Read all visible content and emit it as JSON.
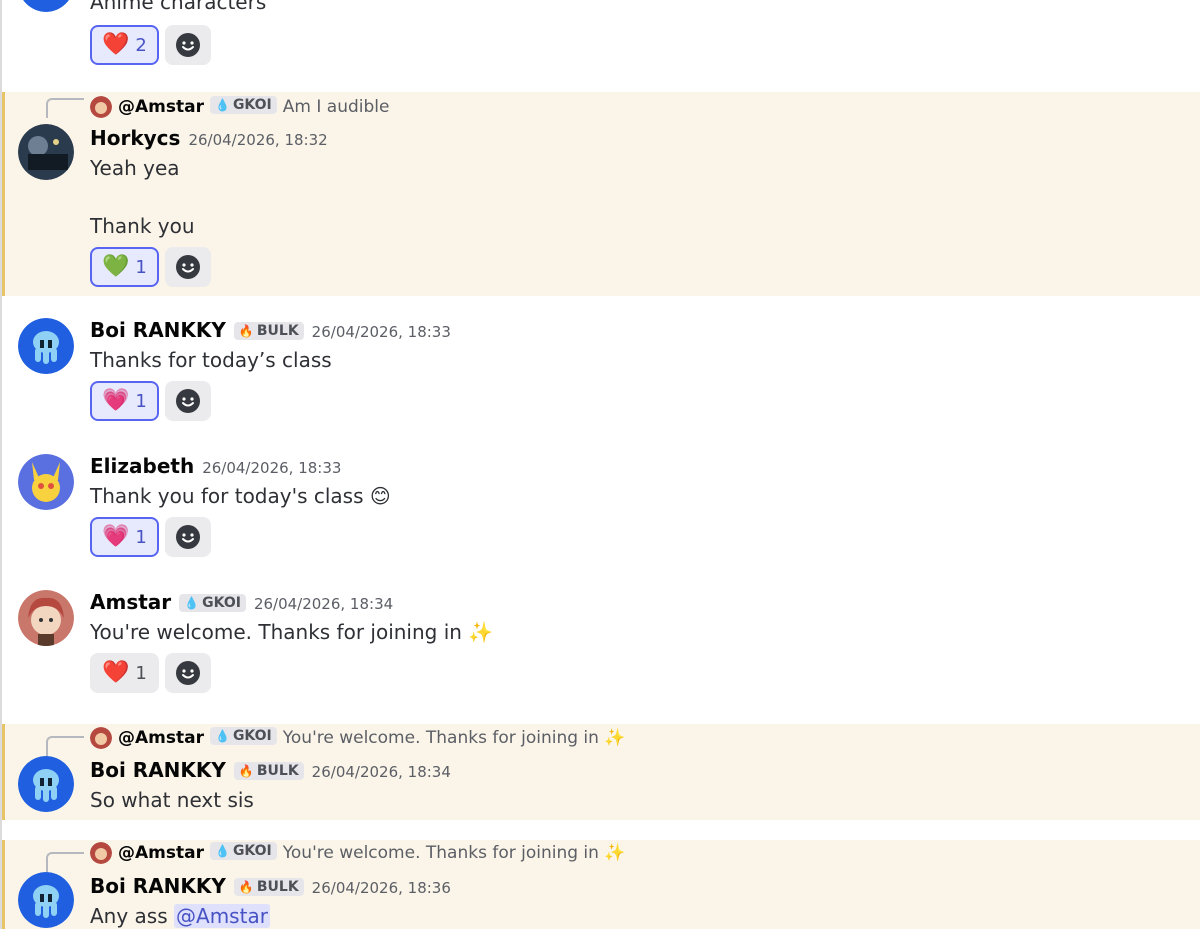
{
  "top_partial": {
    "text": "Anime characters",
    "reactions": [
      {
        "emoji": "❤️",
        "count": "2",
        "me": true
      }
    ]
  },
  "messages": [
    {
      "reply": {
        "name": "@Amstar",
        "tag": "GKOI",
        "text": "Am I audible"
      },
      "username": "Horkycs",
      "timestamp": "26/04/2026, 18:32",
      "lines": [
        "Yeah yea",
        "",
        "Thank you"
      ],
      "reactions": [
        {
          "emoji": "💚",
          "count": "1",
          "me": true
        }
      ]
    },
    {
      "username": "Boi RANKKY",
      "tag": "BULK",
      "timestamp": "26/04/2026, 18:33",
      "lines": [
        "Thanks for today’s class"
      ],
      "reactions": [
        {
          "emoji": "💗",
          "count": "1",
          "me": true
        }
      ]
    },
    {
      "username": "Elizabeth",
      "timestamp": "26/04/2026, 18:33",
      "lines": [
        "Thank you for today's class 😊"
      ],
      "reactions": [
        {
          "emoji": "💗",
          "count": "1",
          "me": true
        }
      ]
    },
    {
      "username": "Amstar",
      "tag": "GKOI",
      "timestamp": "26/04/2026, 18:34",
      "lines": [
        "You're welcome. Thanks for joining in ✨"
      ],
      "reactions": [
        {
          "emoji": "❤️",
          "count": "1",
          "me": false
        }
      ]
    },
    {
      "reply": {
        "name": "@Amstar",
        "tag": "GKOI",
        "text": "You're welcome. Thanks for joining in ✨"
      },
      "username": "Boi RANKKY",
      "tag": "BULK",
      "timestamp": "26/04/2026, 18:34",
      "lines": [
        "So what next sis"
      ]
    },
    {
      "reply": {
        "name": "@Amstar",
        "tag": "GKOI",
        "text": "You're welcome. Thanks for joining in ✨"
      },
      "username": "Boi RANKKY",
      "tag": "BULK",
      "timestamp": "26/04/2026, 18:36",
      "line_prefix": "Any ass ",
      "line_mention": "@Amstar"
    }
  ],
  "icons": {
    "add_reaction": "smiley-add-icon",
    "guild_tag_gkoi": "droplet-icon",
    "guild_tag_bulk": "flame-icon"
  },
  "colors": {
    "mention_bg": "#faf5e8",
    "mention_bar": "#e8c468",
    "reaction_me_border": "#5865f2",
    "blurple": "#5865f2"
  }
}
